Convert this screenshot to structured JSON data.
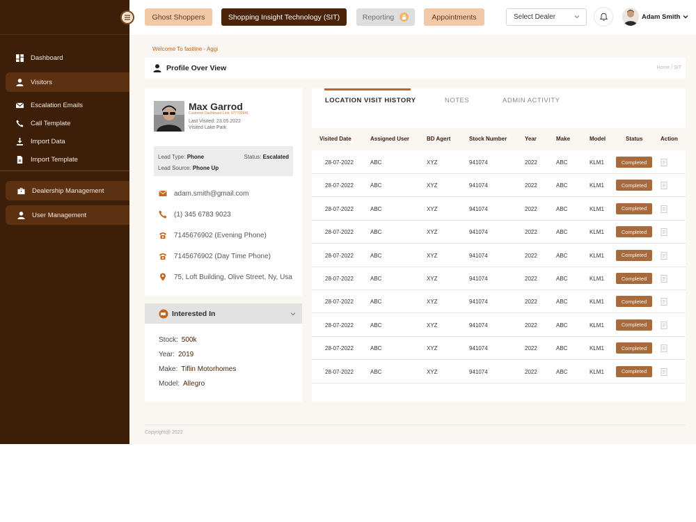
{
  "topbar": {
    "ghost_shoppers": "Ghost Shoppers",
    "sit": "Shopping Insight Technology (SIT)",
    "reporting": "Reporting",
    "appointments": "Appointments",
    "select_dealer": "Select Dealer",
    "user_name": "Adam Smith"
  },
  "sidebar": {
    "items": [
      {
        "label": "Dashboard",
        "icon": "grid-icon"
      },
      {
        "label": "Visitors",
        "icon": "person-icon"
      },
      {
        "label": "Escalation Emails",
        "icon": "mail-icon"
      },
      {
        "label": "Call Template",
        "icon": "phone-icon"
      },
      {
        "label": "Import Data",
        "icon": "download-icon"
      },
      {
        "label": "Import Template",
        "icon": "file-icon"
      }
    ],
    "groups": [
      {
        "label": "Dealership Management",
        "icon": "briefcase-icon"
      },
      {
        "label": "User Management",
        "icon": "person-icon"
      }
    ]
  },
  "page": {
    "welcome": "Welcome To fastline - Aggi",
    "title": "Profile Over View",
    "breadcrumb": "Home / SIT",
    "copyright": "Copyright@ 2022"
  },
  "profile": {
    "name": "Max Garrod",
    "link": "Customer Dashboard Link: 977700941",
    "last_visited": "Last Visited: 23.05.2022",
    "visited": "Visited Lake Park",
    "lead_type_label": "Lead Type:",
    "lead_type": "Phone",
    "status_label": "Status:",
    "status": "Escalated",
    "lead_source_label": "Lead Source:",
    "lead_source": "Phone Up",
    "email": "adam.smith@gmail.com",
    "phone": "(1) 345 6783 9023",
    "evening_phone": "7145676902 (Evening Phone)",
    "day_phone": "7145676902 (Day Time Phone)",
    "address": "75, Loft Building, Olive Street, Ny, Usa"
  },
  "interested": {
    "title": "Interested In",
    "stock_label": "Stock:",
    "stock": "500k",
    "year_label": "Year:",
    "year": "2019",
    "make_label": "Make:",
    "make": "Tiflin Motorhomes",
    "model_label": "Model:",
    "model": "Allegro"
  },
  "tabs": [
    "LOCATION VISIT HISTORY",
    "NOTES",
    "ADMIN ACTIVITY"
  ],
  "table": {
    "headers": [
      "Visited Date",
      "Assigned User",
      "BD Agert",
      "Stock Number",
      "Year",
      "Make",
      "Model",
      "Status",
      "Action"
    ],
    "rows": [
      [
        "28-07-2022",
        "ABC",
        "XYZ",
        "941074",
        "2022",
        "ABC",
        "KLM1",
        "Completed"
      ],
      [
        "28-07-2022",
        "ABC",
        "XYZ",
        "941074",
        "2022",
        "ABC",
        "KLM1",
        "Completed"
      ],
      [
        "28-07-2022",
        "ABC",
        "XYZ",
        "941074",
        "2022",
        "ABC",
        "KLM1",
        "Completed"
      ],
      [
        "28-07-2022",
        "ABC",
        "XYZ",
        "941074",
        "2022",
        "ABC",
        "KLM1",
        "Completed"
      ],
      [
        "28-07-2022",
        "ABC",
        "XYZ",
        "941074",
        "2022",
        "ABC",
        "KLM1",
        "Completed"
      ],
      [
        "28-07-2022",
        "ABC",
        "XYZ",
        "941074",
        "2022",
        "ABC",
        "KLM1",
        "Completed"
      ],
      [
        "28-07-2022",
        "ABC",
        "XYZ",
        "941074",
        "2022",
        "ABC",
        "KLM1",
        "Completed"
      ],
      [
        "28-07-2022",
        "ABC",
        "XYZ",
        "941074",
        "2022",
        "ABC",
        "KLM1",
        "Completed"
      ],
      [
        "28-07-2022",
        "ABC",
        "XYZ",
        "941074",
        "2022",
        "ABC",
        "KLM1",
        "Completed"
      ],
      [
        "28-07-2022",
        "ABC",
        "XYZ",
        "941074",
        "2022",
        "ABC",
        "KLM1",
        "Completed"
      ]
    ]
  },
  "colors": {
    "sidebar": "#3d1e08",
    "accent": "#c2651e",
    "primary_button": "#4a2308",
    "secondary_button": "#f1c9a6",
    "status_badge": "#a66a3c"
  }
}
